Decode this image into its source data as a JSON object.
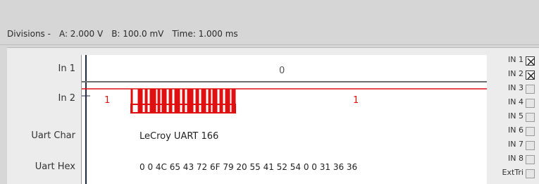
{
  "divisions": {
    "label": "Divisions -",
    "a": "A: 2.000 V",
    "b": "B: 100.0 mV",
    "time": "Time: 1.000 ms"
  },
  "channels": [
    {
      "label": "In 1"
    },
    {
      "label": "In 2"
    },
    {
      "label": "Uart Char"
    },
    {
      "label": "Uart Hex"
    }
  ],
  "plot": {
    "in1_value": "0",
    "in2_value_left": "1",
    "in2_value_right": "1",
    "uart_char": "LeCroy UART  166",
    "uart_hex": "0 0 4C 65 43 72 6F 79 20 55 41 52 54 0 0 31 36 36",
    "colors": {
      "in1": "#6e6e6e",
      "in2": "#e11010",
      "cursor": "#1c2a4a"
    }
  },
  "inputs": [
    {
      "label": "IN 1",
      "checked": true
    },
    {
      "label": "IN 2",
      "checked": true
    },
    {
      "label": "IN 3",
      "checked": false
    },
    {
      "label": "IN 4",
      "checked": false
    },
    {
      "label": "IN 5",
      "checked": false
    },
    {
      "label": "IN 6",
      "checked": false
    },
    {
      "label": "IN 7",
      "checked": false
    },
    {
      "label": "IN 8",
      "checked": false
    },
    {
      "label": "ExtTri",
      "checked": false
    }
  ]
}
